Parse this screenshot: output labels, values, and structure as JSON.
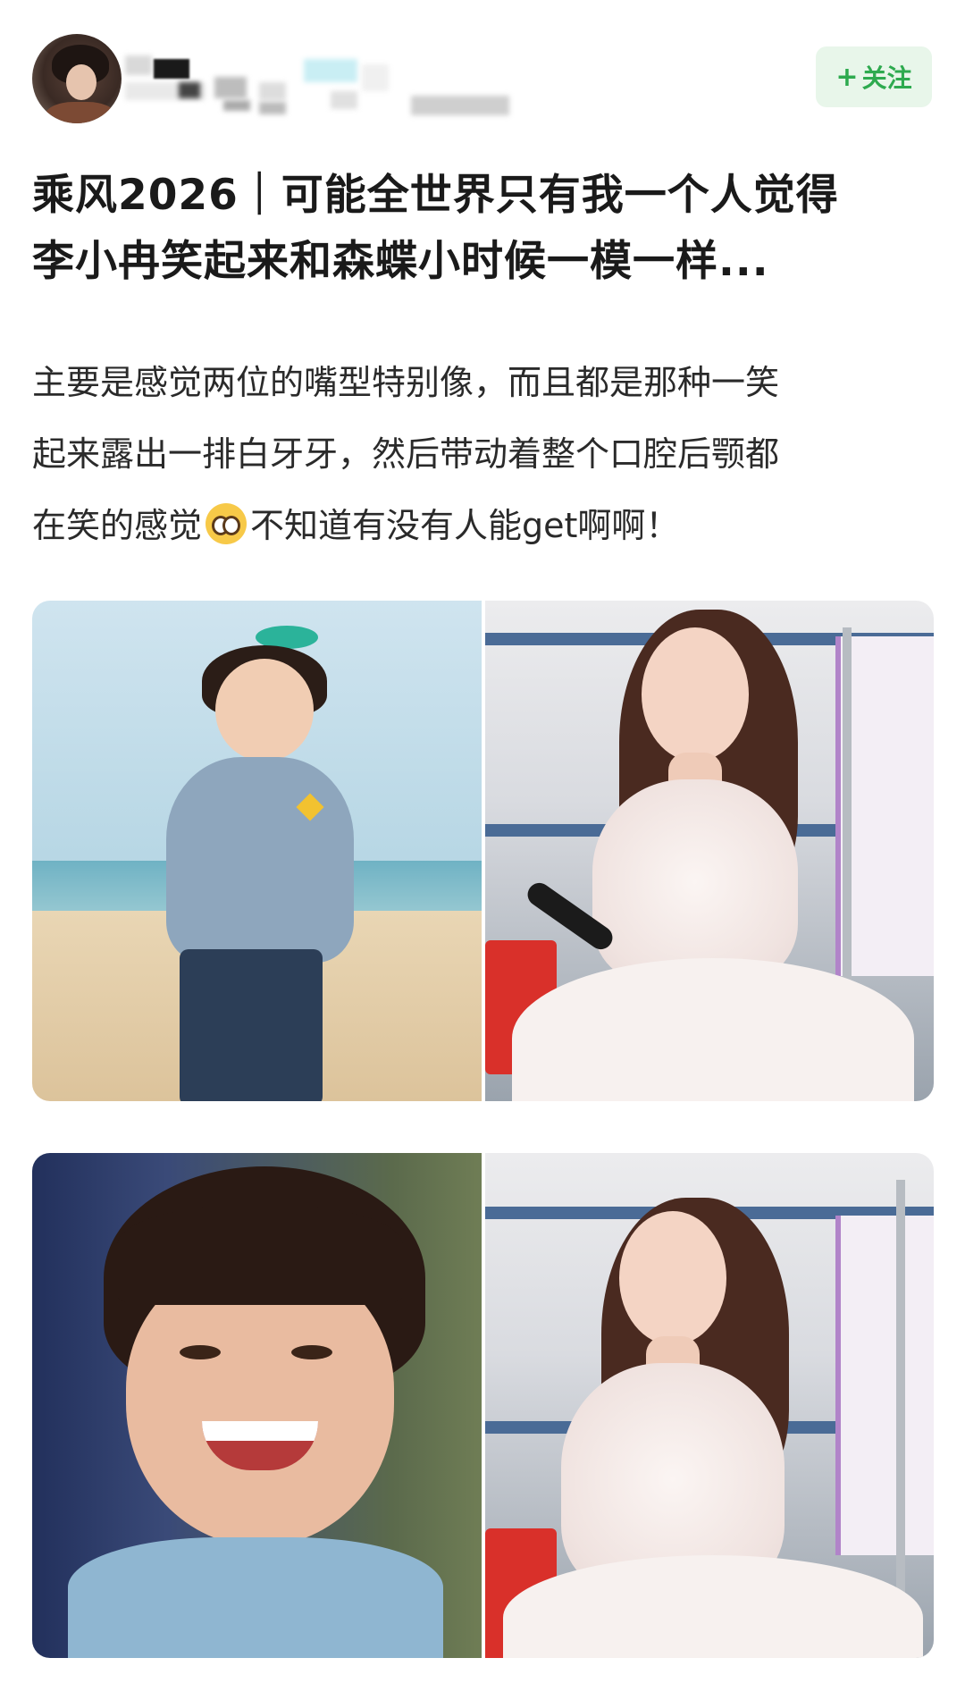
{
  "header": {
    "follow_label": "关注",
    "follow_icon": "plus-icon"
  },
  "post": {
    "title_line1": "乘风2026｜可能全世界只有我一个人觉得",
    "title_line2": "李小冉笑起来和森蝶小时候一模一样...",
    "body_line1": "主要是感觉两位的嘴型特别像，而且都是那种一笑",
    "body_line2": "起来露出一排白牙牙，然后带动着整个口腔后颚都",
    "body_line3_a": "在笑的感觉",
    "body_line3_emoji": "pleading-face-emoji",
    "body_line3_b": "不知道有没有人能get啊啊！"
  },
  "colors": {
    "follow_bg": "#e8f6ea",
    "follow_text": "#2eaa4f",
    "title_text": "#1a1a1a",
    "body_text": "#2a2a2a"
  }
}
